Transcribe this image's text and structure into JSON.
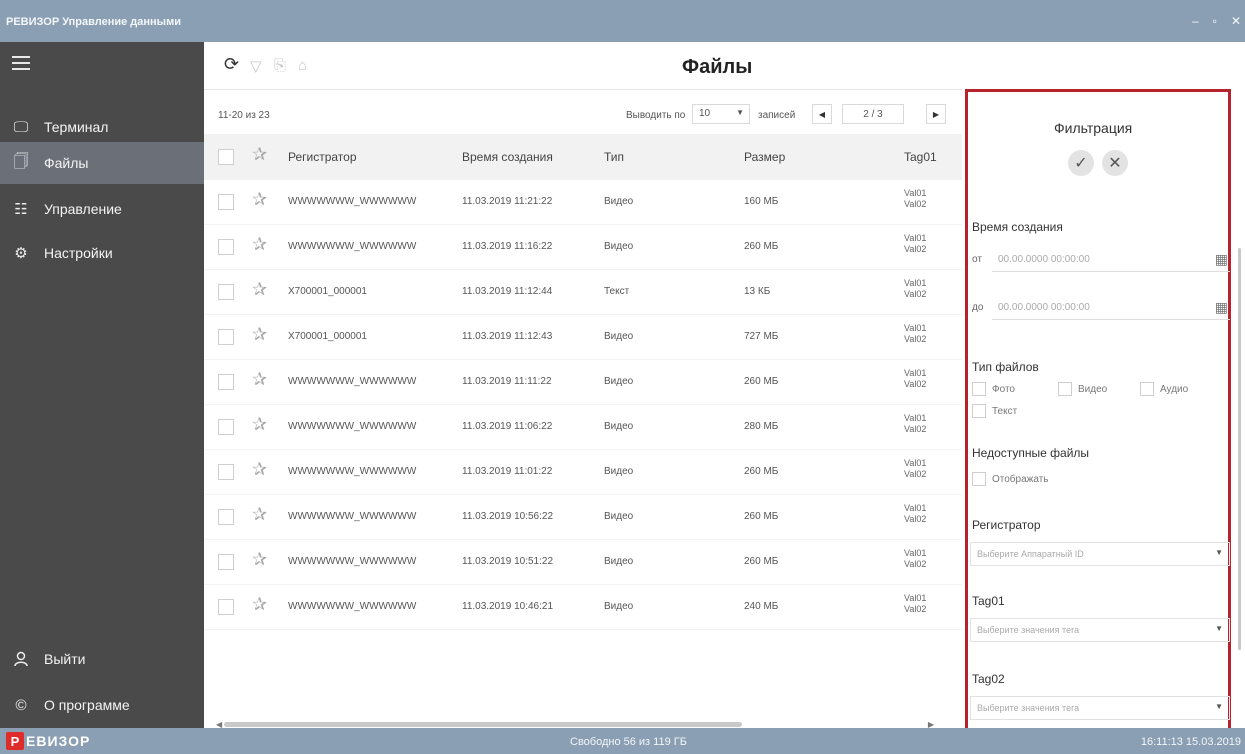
{
  "app": {
    "title": "РЕВИЗОР Управление данными",
    "win_controls": [
      "–",
      "▫",
      "✕"
    ]
  },
  "sidebar": {
    "items": [
      {
        "label": "Терминал",
        "icon": "monitor-icon",
        "glyph": "🖵"
      },
      {
        "label": "Файлы",
        "icon": "file-icon",
        "glyph": "🗍"
      },
      {
        "label": "Управление",
        "icon": "sliders-icon",
        "glyph": "☷"
      },
      {
        "label": "Настройки",
        "icon": "gear-icon",
        "glyph": "⚙"
      }
    ],
    "bottom_items": [
      {
        "label": "Выйти",
        "icon": "user-icon",
        "glyph": "ℵ"
      },
      {
        "label": "О программе",
        "icon": "copyright-icon",
        "glyph": "©"
      }
    ]
  },
  "main": {
    "title": "Файлы",
    "toolbar_icons": [
      "refresh-icon",
      "filter-icon",
      "copy-icon",
      "upload-icon"
    ],
    "pager": {
      "range": "11-20 из 23",
      "per_page_label": "Выводить по",
      "per_page": "10",
      "records_label": "записей",
      "page": "2 / 3",
      "prev": "◀",
      "next": "▶"
    },
    "columns": [
      "Регистратор",
      "Время создания",
      "Тип",
      "Размер",
      "Tag01"
    ],
    "rows": [
      {
        "reg": "WWWWWWW_WWWWWW",
        "time": "11.03.2019 11:21:22",
        "type": "Видео",
        "size": "160 МБ",
        "tag1": "Val01",
        "tag2": "Val02"
      },
      {
        "reg": "WWWWWWW_WWWWWW",
        "time": "11.03.2019 11:16:22",
        "type": "Видео",
        "size": "260 МБ",
        "tag1": "Val01",
        "tag2": "Val02"
      },
      {
        "reg": "X700001_000001",
        "time": "11.03.2019 11:12:44",
        "type": "Текст",
        "size": "13 КБ",
        "tag1": "Val01",
        "tag2": "Val02"
      },
      {
        "reg": "X700001_000001",
        "time": "11.03.2019 11:12:43",
        "type": "Видео",
        "size": "727 МБ",
        "tag1": "Val01",
        "tag2": "Val02"
      },
      {
        "reg": "WWWWWWW_WWWWWW",
        "time": "11.03.2019 11:11:22",
        "type": "Видео",
        "size": "260 МБ",
        "tag1": "Val01",
        "tag2": "Val02"
      },
      {
        "reg": "WWWWWWW_WWWWWW",
        "time": "11.03.2019 11:06:22",
        "type": "Видео",
        "size": "280 МБ",
        "tag1": "Val01",
        "tag2": "Val02"
      },
      {
        "reg": "WWWWWWW_WWWWWW",
        "time": "11.03.2019 11:01:22",
        "type": "Видео",
        "size": "260 МБ",
        "tag1": "Val01",
        "tag2": "Val02"
      },
      {
        "reg": "WWWWWWW_WWWWWW",
        "time": "11.03.2019 10:56:22",
        "type": "Видео",
        "size": "260 МБ",
        "tag1": "Val01",
        "tag2": "Val02"
      },
      {
        "reg": "WWWWWWW_WWWWWW",
        "time": "11.03.2019 10:51:22",
        "type": "Видео",
        "size": "260 МБ",
        "tag1": "Val01",
        "tag2": "Val02"
      },
      {
        "reg": "WWWWWWW_WWWWWW",
        "time": "11.03.2019 10:46:21",
        "type": "Видео",
        "size": "240 МБ",
        "tag1": "Val01",
        "tag2": "Val02"
      }
    ]
  },
  "filter": {
    "title": "Фильтрация",
    "apply_glyph": "✓",
    "reset_glyph": "✕",
    "created_label": "Время создания",
    "from_label": "от",
    "to_label": "до",
    "date_placeholder": "00.00.0000 00:00:00",
    "file_types_label": "Тип файлов",
    "types": [
      "Фото",
      "Видео",
      "Аудио",
      "Текст"
    ],
    "unavailable_label": "Недоступные файлы",
    "show_label": "Отображать",
    "registrar_label": "Регистратор",
    "registrar_placeholder": "Выберите Аппаратный ID",
    "tag01_label": "Tag01",
    "tag01_placeholder": "Выберите значения тега",
    "tag02_label": "Tag02",
    "tag02_placeholder": "Выберите значения тега"
  },
  "status": {
    "brand_p": "Р",
    "brand_rest": "ЕВИЗОР",
    "free": "Свободно 56 из 119 ГБ",
    "time": "16:11:13 15.03.2019"
  },
  "colors": {
    "sidebar": "#4a4a4a",
    "titlebar": "#8a9fb3",
    "accent_red": "#b6232a",
    "brand_red": "#e02b2b"
  }
}
